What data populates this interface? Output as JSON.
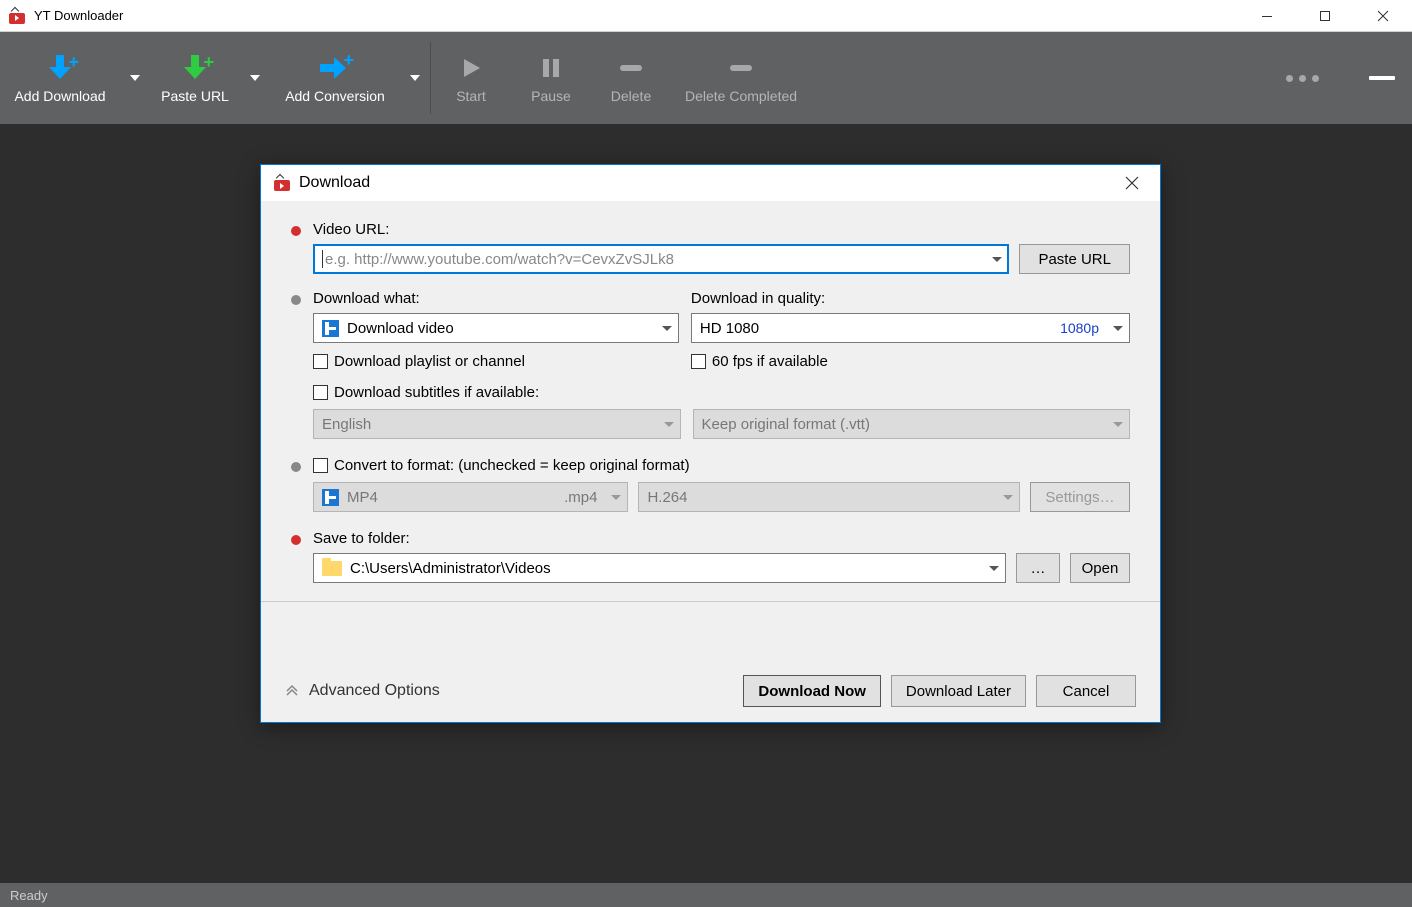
{
  "window": {
    "title": "YT Downloader"
  },
  "toolbar": {
    "add_download": "Add Download",
    "paste_url": "Paste URL",
    "add_conversion": "Add Conversion",
    "start": "Start",
    "pause": "Pause",
    "delete": "Delete",
    "delete_completed": "Delete Completed"
  },
  "statusbar": {
    "text": "Ready"
  },
  "dialog": {
    "title": "Download",
    "video_url_label": "Video URL:",
    "video_url_placeholder": "e.g. http://www.youtube.com/watch?v=CevxZvSJLk8",
    "video_url_value": "",
    "paste_url_btn": "Paste URL",
    "download_what_label": "Download what:",
    "download_what_value": "Download video",
    "download_quality_label": "Download in quality:",
    "download_quality_value": "HD 1080",
    "download_quality_tag": "1080p",
    "playlist_cb": "Download playlist or channel",
    "fps_cb": "60 fps if available",
    "subtitles_cb": "Download subtitles if available:",
    "subtitle_lang": "English",
    "subtitle_format": "Keep original format (.vtt)",
    "convert_cb": "Convert to format: (unchecked = keep original format)",
    "convert_format": "MP4",
    "convert_ext": ".mp4",
    "convert_codec": "H.264",
    "settings_btn": "Settings…",
    "save_label": "Save to folder:",
    "save_path": "C:\\Users\\Administrator\\Videos",
    "browse_btn": "…",
    "open_btn": "Open",
    "advanced": "Advanced Options",
    "download_now": "Download Now",
    "download_later": "Download Later",
    "cancel": "Cancel"
  }
}
